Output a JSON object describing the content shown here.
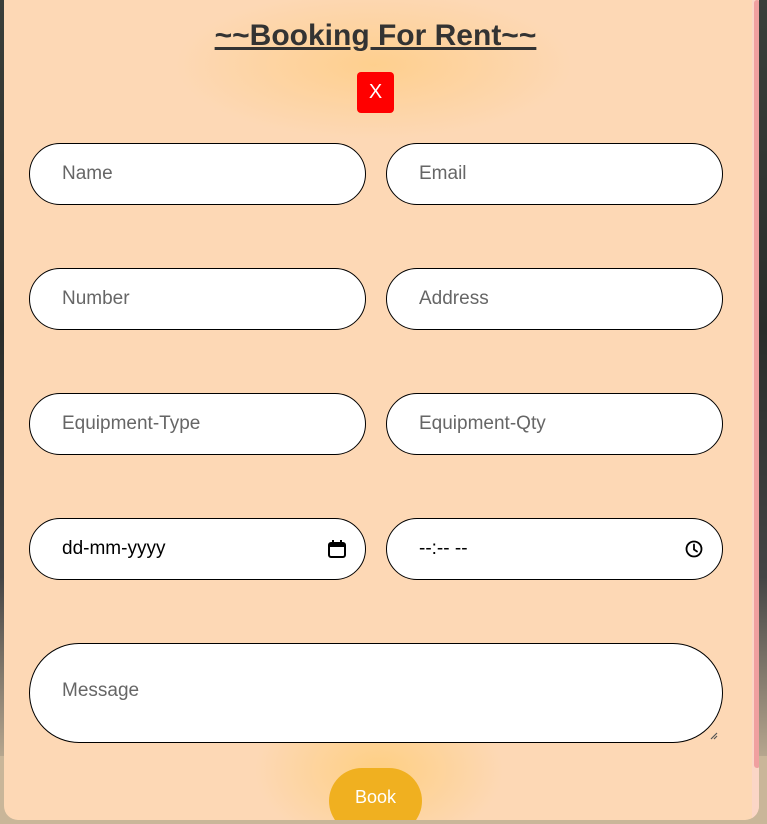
{
  "modal": {
    "title": "~~Booking For Rent~~",
    "close_label": "X",
    "submit_label": "Book"
  },
  "fields": {
    "name": "Name",
    "email": "Email",
    "number": "Number",
    "address": "Address",
    "equipment_type": "Equipment-Type",
    "equipment_qty": "Equipment-Qty",
    "date": "dd-mm-yyyy",
    "time": "--:-- --",
    "message": "Message"
  },
  "icons": {
    "date_icon": "calendar-icon",
    "time_icon": "clock-icon"
  },
  "colors": {
    "modal_bg": "#fdd8b5",
    "close_button": "#ff0000",
    "book_button": "#f0b020"
  }
}
